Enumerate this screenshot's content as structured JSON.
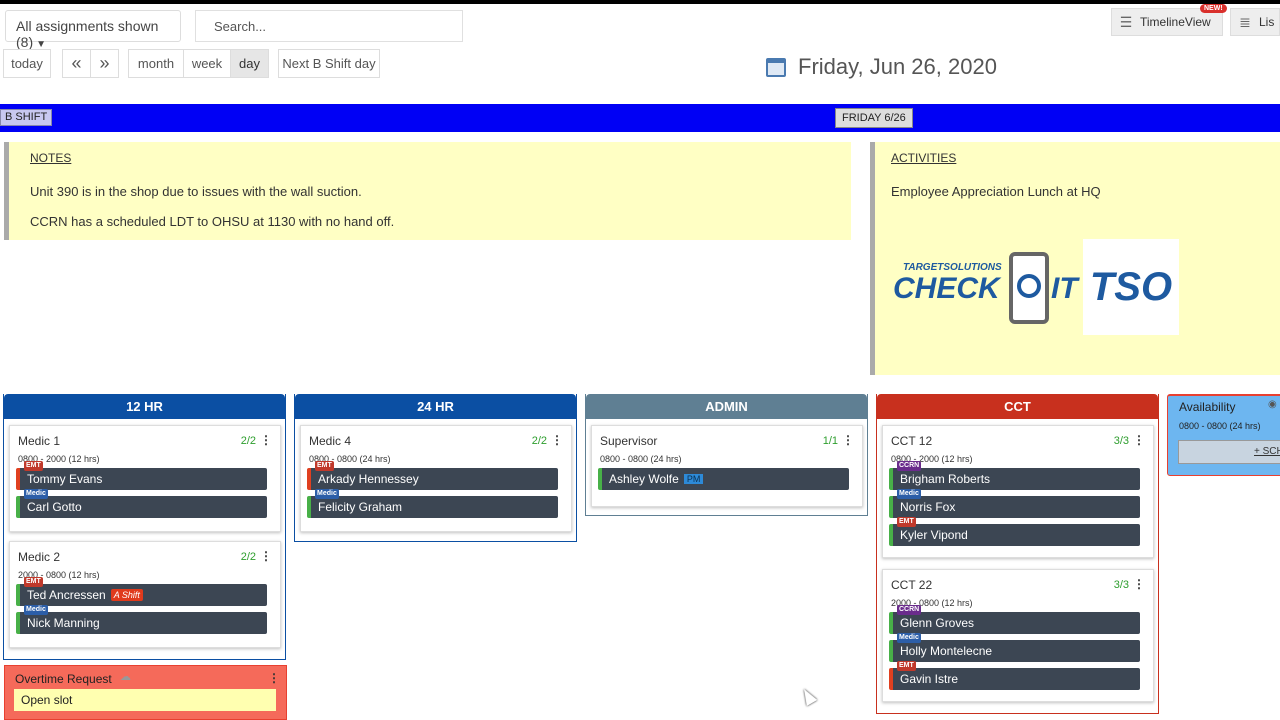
{
  "toolbar": {
    "filter_label": "All assignments shown (8)",
    "search_placeholder": "Search...",
    "timeline_label": "TimelineView",
    "new_badge": "NEW!",
    "list_label": "Lis",
    "today": "today",
    "prev": "«",
    "next": "»",
    "month": "month",
    "week": "week",
    "day": "day",
    "next_shift": "Next B Shift day",
    "date_title": "Friday, Jun 26, 2020"
  },
  "banner": {
    "shift": "B SHIFT",
    "day": "FRIDAY 6/26"
  },
  "notes": {
    "header": "NOTES",
    "lines": [
      "Unit 390 is in the shop due to issues with the wall suction.",
      "CCRN has a scheduled LDT to OHSU at 1130 with no hand off."
    ]
  },
  "activities": {
    "header": "ACTIVITIES",
    "text": "Employee Appreciation Lunch at HQ",
    "logo_text1": "TARGETSOLUTIONS",
    "logo_text2": "CHECK",
    "logo_text3": "IT",
    "logo_text4": "TSO"
  },
  "columns": [
    {
      "title": "12 HR",
      "color": "#0b4fa3"
    },
    {
      "title": "24 HR",
      "color": "#0b4fa3"
    },
    {
      "title": "ADMIN",
      "color": "#5f7f93"
    },
    {
      "title": "CCT",
      "color": "#c8301e"
    }
  ],
  "cards": {
    "medic1": {
      "title": "Medic 1",
      "count": "2/2",
      "time": "0800 - 2000 (12 hrs)",
      "people": [
        {
          "role": "EMT",
          "name": "Tommy Evans"
        },
        {
          "role": "Medic",
          "name": "Carl Gotto"
        }
      ]
    },
    "medic2": {
      "title": "Medic 2",
      "count": "2/2",
      "time": "2000 - 0800 (12 hrs)",
      "people": [
        {
          "role": "EMT",
          "name": "Ted Ancressen",
          "tag": "A Shift"
        },
        {
          "role": "Medic",
          "name": "Nick Manning"
        }
      ]
    },
    "medic4": {
      "title": "Medic 4",
      "count": "2/2",
      "time": "0800 - 0800 (24 hrs)",
      "people": [
        {
          "role": "EMT",
          "name": "Arkady Hennessey"
        },
        {
          "role": "Medic",
          "name": "Felicity Graham"
        }
      ]
    },
    "supervisor": {
      "title": "Supervisor",
      "count": "1/1",
      "time": "0800 - 0800 (24 hrs)",
      "people": [
        {
          "name": "Ashley Wolfe",
          "tag": "PM"
        }
      ]
    },
    "cct12": {
      "title": "CCT 12",
      "count": "3/3",
      "time": "0800 - 2000 (12 hrs)",
      "people": [
        {
          "role": "CCRN",
          "name": "Brigham Roberts"
        },
        {
          "role": "Medic",
          "name": "Norris Fox"
        },
        {
          "role": "EMT",
          "name": "Kyler Vipond"
        }
      ]
    },
    "cct22": {
      "title": "CCT 22",
      "count": "3/3",
      "time": "2000 - 0800 (12 hrs)",
      "people": [
        {
          "role": "CCRN",
          "name": "Glenn Groves"
        },
        {
          "role": "Medic",
          "name": "Holly Montelecne"
        },
        {
          "role": "EMT",
          "name": "Gavin Istre"
        }
      ]
    }
  },
  "overtime": {
    "title": "Overtime Request",
    "slot": "Open slot"
  },
  "availability": {
    "title": "Availability",
    "time": "0800 - 0800 (24 hrs)",
    "button": "+ SCH"
  }
}
